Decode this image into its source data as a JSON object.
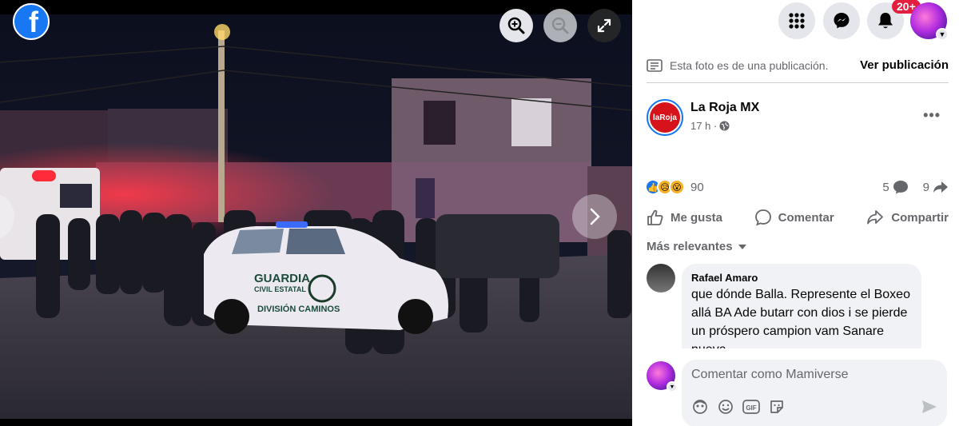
{
  "viewer": {
    "logo_letter": "f",
    "zoom_in_icon": "zoom-in-icon",
    "zoom_out_icon": "zoom-out-icon",
    "fullscreen_icon": "fullscreen-icon",
    "next_icon": "chevron-right-icon",
    "photo_text": {
      "car_line1": "GUARDIA",
      "car_line2": "CIVIL ESTATAL",
      "car_line3": "DIVISIÓN CAMINOS"
    }
  },
  "topbar": {
    "menu_icon": "grid-menu-icon",
    "messenger_icon": "messenger-icon",
    "notifications_icon": "bell-icon",
    "notifications_badge": "20+"
  },
  "notice": {
    "text": "Esta foto es de una publicación.",
    "link": "Ver publicación"
  },
  "post": {
    "page_name": "La Roja MX",
    "avatar_text": "laRoja",
    "time": "17 h ·",
    "reaction_count": "90",
    "comment_count": "5",
    "share_count": "9"
  },
  "actions": {
    "like": "Me gusta",
    "comment": "Comentar",
    "share": "Compartir"
  },
  "relevance": "Más relevantes",
  "comment": {
    "author": "Rafael Amaro",
    "text": "que dónde Balla. Represente el Boxeo allá BA Ade butarr con dios i se pierde un próspero campion vam Sanare nueva"
  },
  "composer": {
    "placeholder": "Comentar como Mamiverse"
  },
  "colors": {
    "facebook_blue": "#1877f2",
    "badge_red": "#e41e3f",
    "secondary_text": "#65676b"
  }
}
